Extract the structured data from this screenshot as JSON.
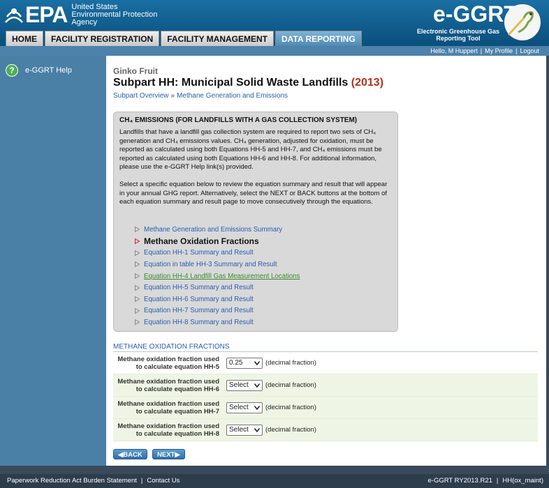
{
  "header": {
    "epa_wordmark": "EPA",
    "agency_line1": "United States",
    "agency_line2": "Environmental Protection",
    "agency_line3": "Agency",
    "app_logo": "e-GGRT",
    "app_sub_line1": "Electronic Greenhouse Gas",
    "app_sub_line2": "Reporting Tool"
  },
  "nav": {
    "tabs": [
      {
        "label": "HOME"
      },
      {
        "label": "FACILITY REGISTRATION"
      },
      {
        "label": "FACILITY MANAGEMENT"
      },
      {
        "label": "DATA REPORTING"
      }
    ]
  },
  "userbar": {
    "greeting": "Hello, M Huppert",
    "profile": "My Profile",
    "logout": "Logout"
  },
  "sidebar": {
    "help_label": "e-GGRT Help"
  },
  "main": {
    "facility": "Ginko Fruit",
    "title": "Subpart HH: Municipal Solid Waste Landfills ",
    "year": "(2013)",
    "breadcrumb": [
      "Subpart Overview",
      "»",
      "Methane Generation and Emissions"
    ]
  },
  "infobox": {
    "heading": "CH₄ EMISSIONS (FOR LANDFILLS WITH A GAS COLLECTION SYSTEM)",
    "para1": "Landfills that have a landfill gas collection system are required to report two sets of CH₄ generation and CH₄ emissions values. CH₄ generation, adjusted for oxidation, must be reported as calculated using both Equations HH-5 and HH-7, and CH₄ emissions must be reported as calculated using both Equations HH-6 and HH-8. For additional information, please use the e-GGRT Help link(s) provided.",
    "para2": "Select a specific equation below to review the equation summary and result that will appear in your annual GHG report. Alternatively, select the NEXT or BACK buttons at the bottom of each equation summary and result page to move consecutively through the equations.",
    "links": [
      {
        "label": "Methane Generation and Emissions Summary",
        "state": "normal"
      },
      {
        "label": "Methane Oxidation Fractions",
        "state": "current"
      },
      {
        "label": "Equation HH-1 Summary and Result",
        "state": "normal"
      },
      {
        "label": "Equation in table HH-3 Summary and Result",
        "state": "normal"
      },
      {
        "label": "Equation HH-4 Landfill Gas Measurement Locations",
        "state": "visited"
      },
      {
        "label": "Equation HH-5 Summary and Result",
        "state": "normal"
      },
      {
        "label": "Equation HH-6 Summary and Result",
        "state": "normal"
      },
      {
        "label": "Equation HH-7 Summary and Result",
        "state": "normal"
      },
      {
        "label": "Equation HH-8 Summary and Result",
        "state": "normal"
      }
    ]
  },
  "form": {
    "heading": "METHANE OXIDATION FRACTIONS",
    "unit": "(decimal fraction)",
    "rows": [
      {
        "label1": "Methane oxidation fraction used",
        "label2": "to calculate equation HH-5",
        "value": "0.25"
      },
      {
        "label1": "Methane oxidation fraction used",
        "label2": "to calculate equation HH-6",
        "value": "Select"
      },
      {
        "label1": "Methane oxidation fraction used",
        "label2": "to calculate equation HH-7",
        "value": "Select"
      },
      {
        "label1": "Methane oxidation fraction used",
        "label2": "to calculate equation HH-8",
        "value": "Select"
      }
    ]
  },
  "buttons": {
    "back": "◀BACK",
    "next": "NEXT▶"
  },
  "footer": {
    "paperwork": "Paperwork Reduction Act Burden Statement",
    "contact": "Contact Us",
    "version": "e-GGRT RY2013.R21",
    "server": "HH(ox_maint)"
  },
  "colors": {
    "header_blue": "#0b5d8f",
    "sidebar_blue": "#4a7fa6",
    "link_blue": "#2a5db0",
    "year_red": "#b2331c"
  }
}
